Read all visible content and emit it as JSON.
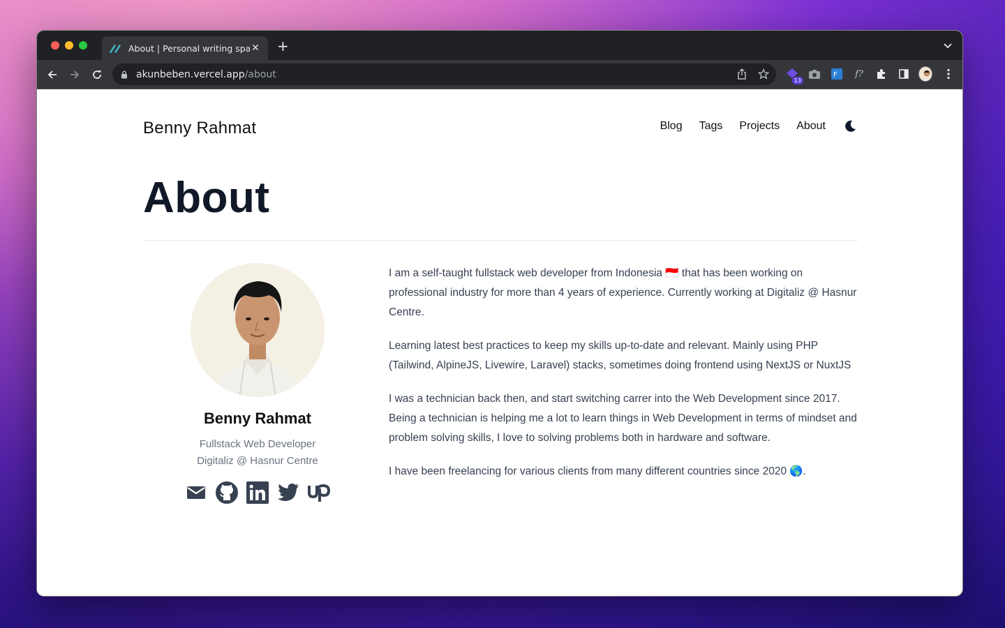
{
  "browser": {
    "tab_title": "About | Personal writing space",
    "url_host": "akunbeben.vercel.app",
    "url_path": "/about",
    "extension_badge": "13"
  },
  "site": {
    "title": "Benny Rahmat",
    "nav": [
      "Blog",
      "Tags",
      "Projects",
      "About"
    ]
  },
  "page": {
    "heading": "About"
  },
  "profile": {
    "name": "Benny Rahmat",
    "role": "Fullstack Web Developer",
    "company": "Digitaliz @ Hasnur Centre",
    "socials": [
      "mail-icon",
      "github-icon",
      "linkedin-icon",
      "twitter-icon",
      "upwork-icon"
    ]
  },
  "bio": [
    "I am a self-taught fullstack web developer from Indonesia 🇮🇩 that has been working on professional industry for more than 4 years of experience. Currently working at Digitaliz @ Hasnur Centre.",
    "Learning latest best practices to keep my skills up-to-date and relevant. Mainly using PHP (Tailwind, AlpineJS, Livewire, Laravel) stacks, sometimes doing frontend using NextJS or NuxtJS",
    "I was a technician back then, and start switching carrer into the Web Development since 2017. Being a technician is helping me a lot to learn things in Web Development in terms of mindset and problem solving skills, I love to solving problems both in hardware and software.",
    "I have been freelancing for various clients from many different countries since 2020 🌎."
  ]
}
